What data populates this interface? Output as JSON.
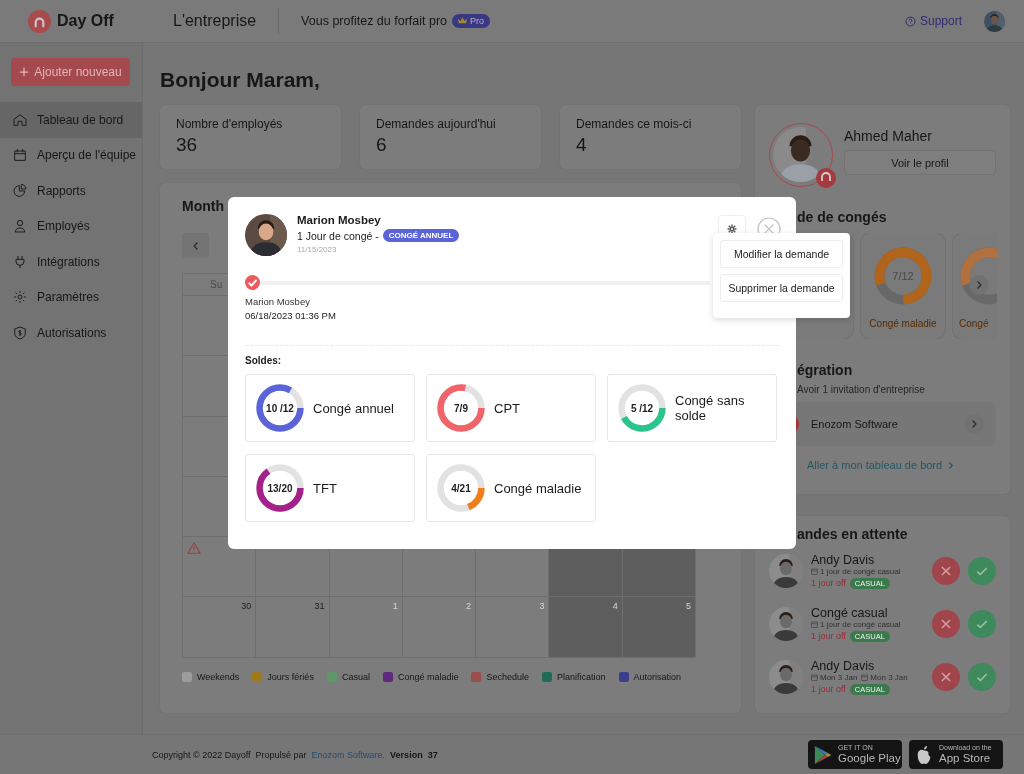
{
  "header": {
    "logo": "Day Off",
    "company": "L'entreprise",
    "plan_text": "Vous profitez du forfait pro",
    "plan_badge": "Pro",
    "support": "Support"
  },
  "sidebar": {
    "add_button": "Ajouter nouveau",
    "items": [
      {
        "label": "Tableau de bord",
        "selected": true
      },
      {
        "label": "Aperçu de l'équipe",
        "selected": false
      },
      {
        "label": "Rapports",
        "selected": false
      },
      {
        "label": "Employés",
        "selected": false
      },
      {
        "label": "Intégrations",
        "selected": false
      },
      {
        "label": "Paramètres",
        "selected": false
      },
      {
        "label": "Autorisations",
        "selected": false
      }
    ]
  },
  "greeting": "Bonjour Maram,",
  "stats": [
    {
      "label": "Nombre d'employés",
      "value": "36"
    },
    {
      "label": "Demandes aujourd'hui",
      "value": "6"
    },
    {
      "label": "Demandes ce mois-ci",
      "value": "4"
    }
  ],
  "calendar": {
    "title": "Month",
    "weekday": "Su",
    "rows": [
      {
        "cells": [
          {
            "weekend": false,
            "alert": true
          },
          {
            "weekend": false,
            "alert": false
          },
          {
            "weekend": false,
            "alert": false
          },
          {
            "weekend": false,
            "alert": false
          },
          {
            "weekend": false,
            "alert": false
          },
          {
            "weekend": true,
            "alert": false
          },
          {
            "weekend": true,
            "alert": false
          }
        ]
      },
      {
        "cells": [
          {
            "day": "30",
            "outside": false,
            "weekend": false
          },
          {
            "day": "31",
            "outside": false,
            "weekend": false
          },
          {
            "day": "1",
            "outside": true,
            "weekend": false
          },
          {
            "day": "2",
            "outside": true,
            "weekend": false
          },
          {
            "day": "3",
            "outside": true,
            "weekend": false
          },
          {
            "day": "4",
            "outside": true,
            "weekend": true
          },
          {
            "day": "5",
            "outside": true,
            "weekend": true
          }
        ]
      }
    ],
    "legend": [
      {
        "label": "Weekends",
        "color": "#9c9c9c"
      },
      {
        "label": "Jours fériés",
        "color": "#a07a1a"
      },
      {
        "label": "Casual",
        "color": "#5e9868"
      },
      {
        "label": "Congé maladie",
        "color": "#5e2a7c"
      },
      {
        "label": "Sechedule",
        "color": "#9c4c4c"
      },
      {
        "label": "Planification",
        "color": "#1e6c56"
      },
      {
        "label": "Autorisation",
        "color": "#3c408c"
      }
    ]
  },
  "profile": {
    "name": "Ahmed Maher",
    "button": "Voir le profil"
  },
  "leave_balance": {
    "title": "de de congés",
    "cards": [
      {
        "value": "7/12",
        "label": "Congé maladie",
        "color": "#b0641c"
      },
      {
        "label": "Congé",
        "color": "#b07040"
      }
    ]
  },
  "integration": {
    "title": "égration",
    "subtitle": "Avoir 1 invitation d'entreprise",
    "company": "Enozom Software",
    "link": "Aller à mon tableau de bord"
  },
  "pending": {
    "title": "andes en attente",
    "items": [
      {
        "name": "Andy Davis",
        "details": [
          "1 jour de congé casual"
        ],
        "days": "1 jour off",
        "type": "CASUAL"
      },
      {
        "name": "Congé casual",
        "details": [
          "1 jour de congé casual"
        ],
        "days": "1 jour off",
        "type": "CASUAL"
      },
      {
        "name": "Andy Davis",
        "details": [
          "Mon 3 Jan",
          "Mon 3 Jan"
        ],
        "days": "1 jour off",
        "type": "CASUAL"
      }
    ]
  },
  "footer": {
    "copyright": "Copyright © 2022 Dayoff",
    "powered": "Propulsé par",
    "company_link": "Enozom Software.",
    "version_label": "Version",
    "version": "37"
  },
  "stores": [
    {
      "small": "GET IT ON",
      "name": "Google Play"
    },
    {
      "small": "Download on the",
      "name": "App Store"
    }
  ],
  "modal": {
    "name": "Marion Mosbey",
    "leave_text": "1 Jour de congé -",
    "leave_type": "CONGÉ ANNUEL",
    "date": "11/15/2023",
    "timeline": [
      {
        "name": "Marion Mosbey",
        "time": "06/18/2023 01:36 PM",
        "done": true
      }
    ],
    "menu": [
      "Modifier la demande",
      "Supprimer la demande"
    ],
    "balances_title": "Soldes:",
    "balances": [
      {
        "value": "10 /12",
        "label": "Congé annuel",
        "level": 0.83,
        "color": "#5b63d9"
      },
      {
        "value": "7/9",
        "label": "CPT",
        "level": 0.78,
        "color": "#f0646a"
      },
      {
        "value": "5 /12",
        "label": "Congé sans solde",
        "level": 0.42,
        "color": "#2bc48a"
      },
      {
        "value": "13/20",
        "label": "TFT",
        "level": 0.65,
        "color": "#a4218a"
      },
      {
        "value": "4/21",
        "label": "Congé maladie",
        "level": 0.19,
        "color": "#f07e1a"
      }
    ]
  }
}
